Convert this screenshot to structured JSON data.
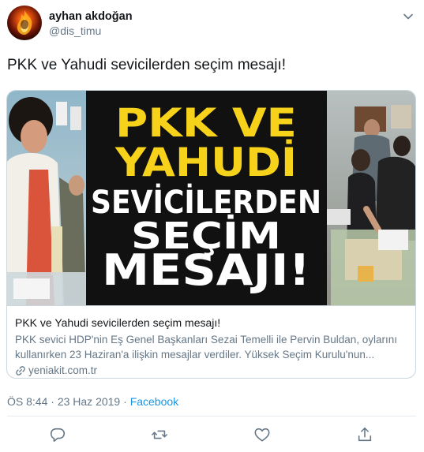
{
  "user": {
    "display_name": "ayhan akdoğan",
    "handle": "@dis_timu"
  },
  "tweet": {
    "text": "PKK ve Yahudi sevicilerden seçim mesajı!"
  },
  "card": {
    "headline_lines": [
      "PKK VE",
      "YAHUDİ",
      "SEVİCİLERDEN",
      "SEÇİM",
      "MESAJI!"
    ],
    "title": "PKK ve Yahudi sevicilerden seçim mesajı!",
    "description": "PKK sevici HDP'nin Eş Genel Başkanları Sezai Temelli ile Pervin Buldan, oylarını kullanırken 23 Haziran'a ilişkin mesajlar verdiler. Yüksek Seçim Kurulu'nun...",
    "domain": "yeniakit.com.tr"
  },
  "meta": {
    "time": "ÖS 8:44",
    "date": "23 Haz 2019",
    "separator": "·",
    "source": "Facebook"
  },
  "colors": {
    "text": "#14171a",
    "secondary": "#657786",
    "link": "#1b95e0",
    "border": "#ccd6dd",
    "headline_yellow": "#f7d21b",
    "headline_white": "#ffffff"
  },
  "icons": [
    "caret-down-icon",
    "link-icon",
    "reply-icon",
    "retweet-icon",
    "like-icon",
    "share-icon"
  ]
}
